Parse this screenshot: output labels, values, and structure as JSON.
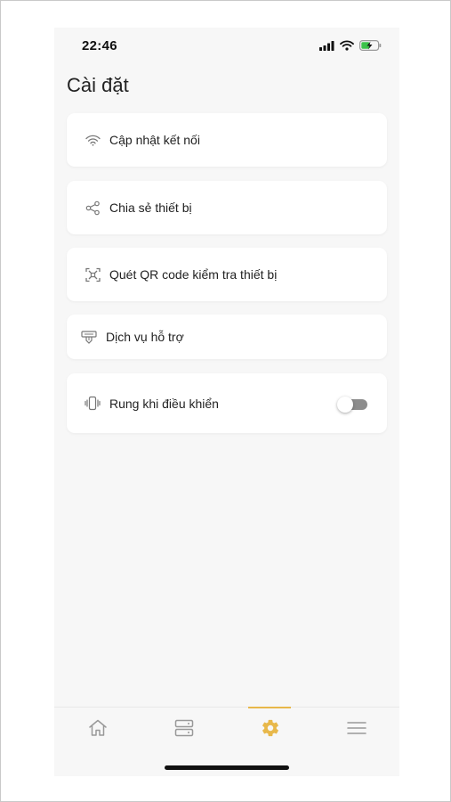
{
  "status": {
    "time": "22:46",
    "icons": [
      "signal-icon",
      "wifi-icon",
      "battery-charging-icon"
    ]
  },
  "page": {
    "title": "Cài đặt"
  },
  "settings": {
    "items": [
      {
        "label": "Cập nhật kết nối",
        "icon": "wifi-icon"
      },
      {
        "label": "Chia sẻ thiết bị",
        "icon": "share-icon"
      },
      {
        "label": "Quét QR code kiểm tra thiết bị",
        "icon": "qr-scan-icon"
      },
      {
        "label": "Dịch vụ hỗ trợ",
        "icon": "support-icon"
      },
      {
        "label": "Rung khi điều khiển",
        "icon": "vibrate-icon",
        "toggle": false
      }
    ]
  },
  "tabs": [
    {
      "name": "home",
      "icon": "home-icon",
      "active": false
    },
    {
      "name": "devices",
      "icon": "devices-icon",
      "active": false
    },
    {
      "name": "settings",
      "icon": "gear-icon",
      "active": true
    },
    {
      "name": "menu",
      "icon": "menu-icon",
      "active": false
    }
  ],
  "colors": {
    "accent": "#e8b84a",
    "background": "#f7f7f7",
    "card": "#ffffff",
    "toggle_off": "#8d8d8d"
  }
}
